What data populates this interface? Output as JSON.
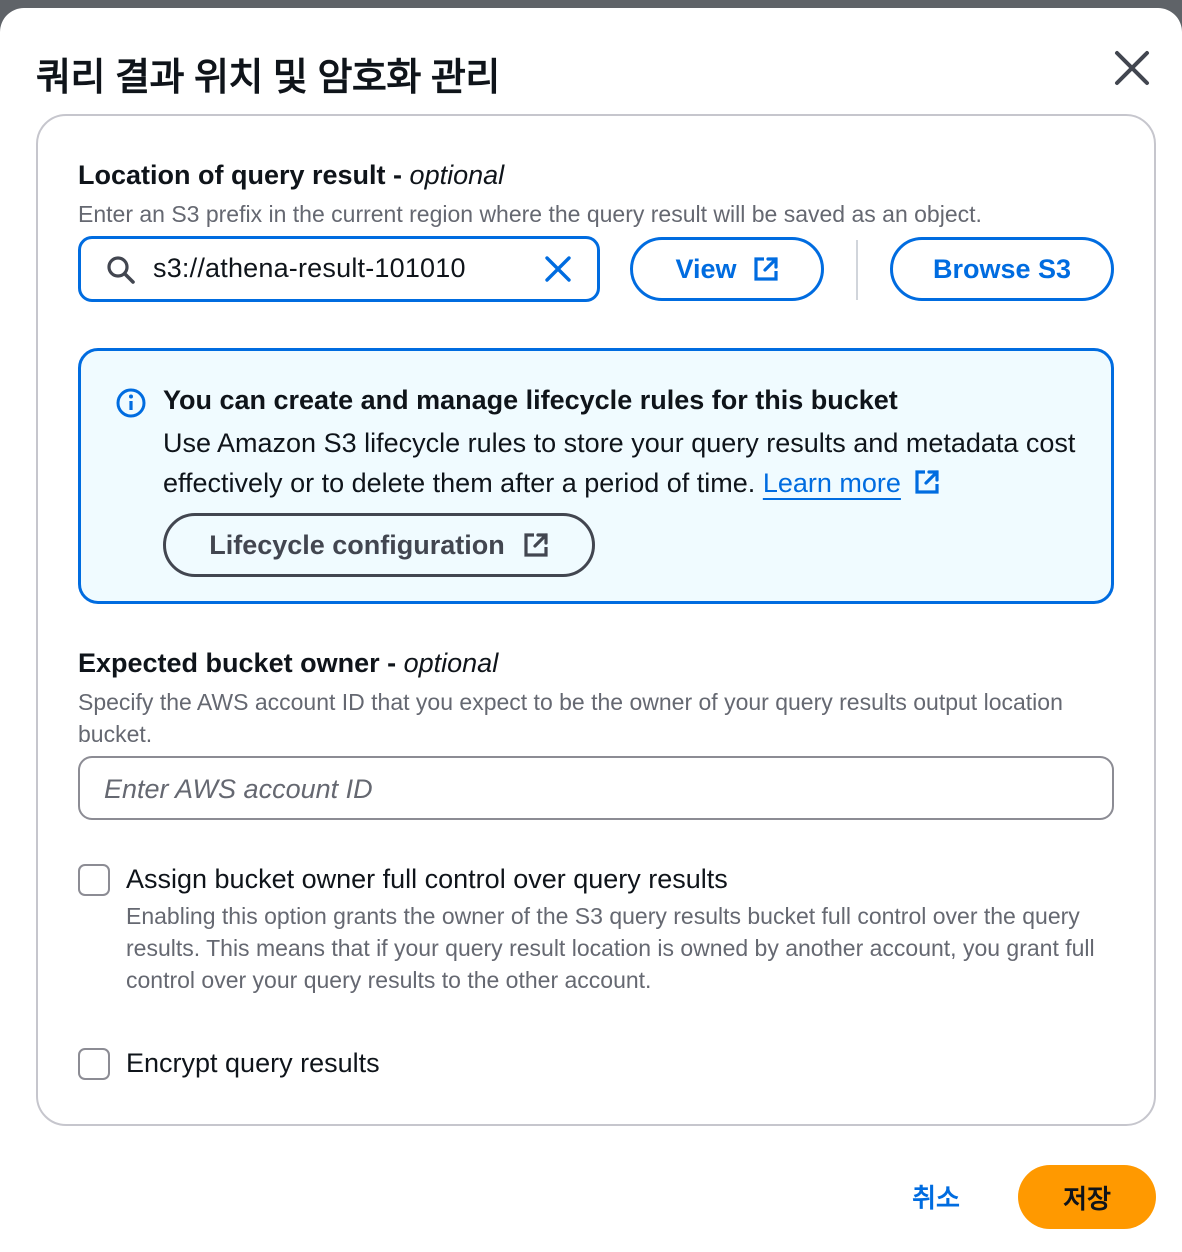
{
  "modal": {
    "title": "쿼리 결과 위치 및 암호화 관리"
  },
  "location": {
    "label": "Location of query result -",
    "optional": "optional",
    "description": "Enter an S3 prefix in the current region where the query result will be saved as an object.",
    "input_value": "s3://athena-result-101010",
    "view_label": "View",
    "browse_label": "Browse S3"
  },
  "info": {
    "title": "You can create and manage lifecycle rules for this bucket",
    "body": "Use Amazon S3 lifecycle rules to store your query results and metadata cost effectively or to delete them after a period of time.",
    "learn_more": "Learn more",
    "button_label": "Lifecycle configuration"
  },
  "owner": {
    "label": "Expected bucket owner -",
    "optional": "optional",
    "description": "Specify the AWS account ID that you expect to be the owner of your query results output location bucket.",
    "placeholder": "Enter AWS account ID"
  },
  "full_control": {
    "label": "Assign bucket owner full control over query results",
    "description": "Enabling this option grants the owner of the S3 query results bucket full control over the query results. This means that if your query result location is owned by another account, you grant full control over your query results to the other account.",
    "checked": false
  },
  "encrypt": {
    "label": "Encrypt query results",
    "checked": false
  },
  "footer": {
    "cancel_label": "취소",
    "save_label": "저장"
  },
  "colors": {
    "accent": "#006ce0",
    "primary_button": "#ff9900",
    "info_background": "#f0fbff"
  }
}
